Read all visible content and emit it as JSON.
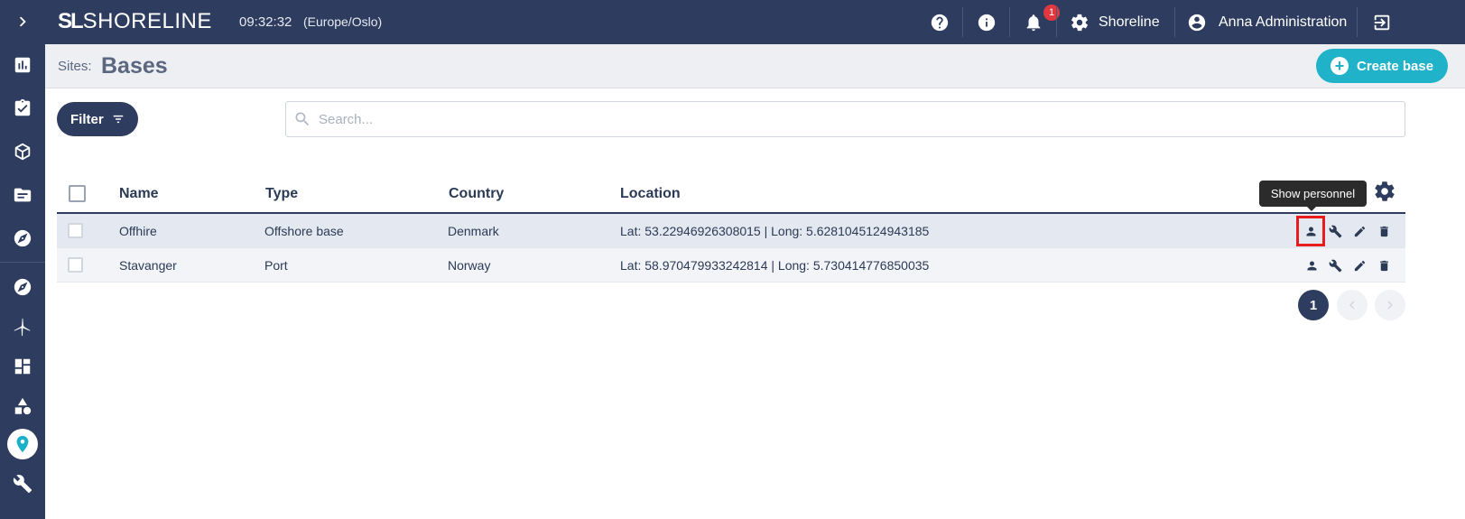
{
  "app": {
    "brand": "SHORELINE",
    "brand_mark": "SL",
    "time": "09:32:32",
    "timezone": "(Europe/Oslo)"
  },
  "topbar": {
    "notifications_count": "1",
    "settings_label": "Shoreline",
    "user_label": "Anna Administration"
  },
  "page": {
    "prefix": "Sites:",
    "title": "Bases",
    "create_label": "Create base"
  },
  "toolbar": {
    "filter_label": "Filter",
    "search_placeholder": "Search..."
  },
  "table": {
    "headers": [
      "Name",
      "Type",
      "Country",
      "Location"
    ],
    "rows": [
      {
        "name": "Offhire",
        "type": "Offshore base",
        "country": "Denmark",
        "location": "Lat: 53.22946926308015 | Long: 5.6281045124943185"
      },
      {
        "name": "Stavanger",
        "type": "Port",
        "country": "Norway",
        "location": "Lat: 58.970479933242814 | Long: 5.730414776850035"
      }
    ]
  },
  "tooltip": {
    "text": "Show personnel"
  },
  "pagination": {
    "current": "1"
  },
  "colors": {
    "navy": "#2e3d5f",
    "accent": "#1fb2c9",
    "highlight": "#e81c1c",
    "badge": "#e0383e"
  }
}
